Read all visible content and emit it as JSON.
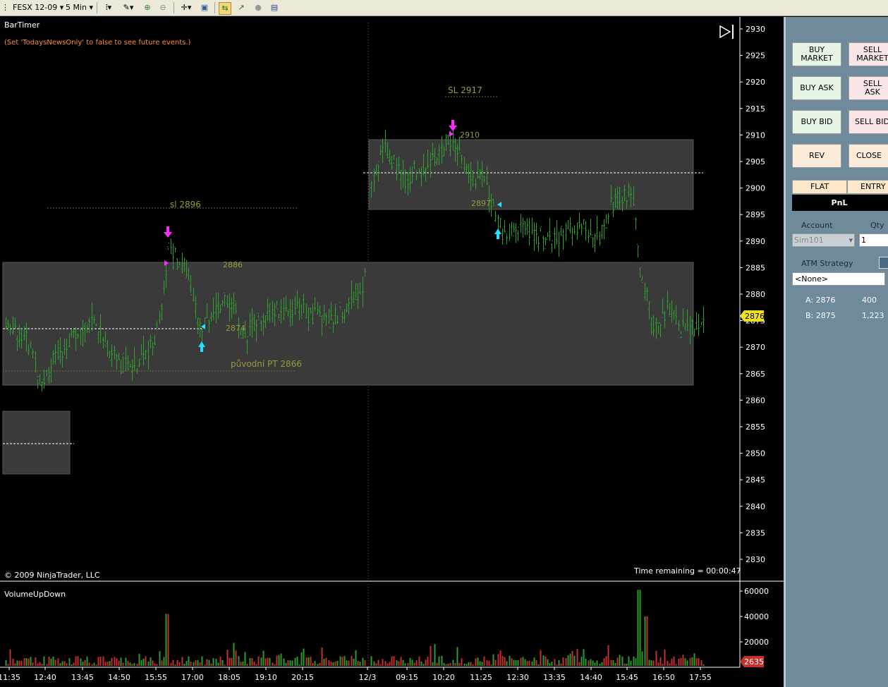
{
  "toolbar": {
    "instrument": "FESX 12-09",
    "period": "5 Min"
  },
  "chart": {
    "indicator_title": "BarTimer",
    "news_note": "(Set 'TodaysNewsOnly' to false to see future events.)",
    "copyright": "© 2009 NinjaTrader, LLC",
    "time_remaining": "Time remaining = 00:00:47",
    "volume_title": "VolumeUpDown",
    "price_ticks": [
      "2930",
      "2925",
      "2920",
      "2915",
      "2910",
      "2905",
      "2900",
      "2895",
      "2890",
      "2885",
      "2880",
      "2875",
      "2870",
      "2865",
      "2860",
      "2855",
      "2850",
      "2845",
      "2840",
      "2835",
      "2830"
    ],
    "current_price": "2876",
    "volume_ticks": [
      "60000",
      "40000",
      "20000"
    ],
    "current_volume": "2635",
    "time_ticks": [
      "11:35",
      "12:40",
      "13:45",
      "14:50",
      "15:55",
      "17:00",
      "18:05",
      "19:10",
      "20:15",
      "12/3",
      "09:15",
      "10:20",
      "11:25",
      "12:30",
      "13:35",
      "14:40",
      "15:45",
      "16:50",
      "17:55"
    ],
    "annotations": {
      "sl1": "sl  2896",
      "sl2": "SL 2917",
      "lvl_2886": "2886",
      "lvl_2874": "2874",
      "lvl_2866": "původní PT 2866",
      "lvl_2910": "2910",
      "lvl_2897": "2897"
    }
  },
  "panel": {
    "buy_market": "BUY MARKET",
    "sell_market": "SELL MARKET",
    "buy_ask": "BUY ASK",
    "sell_ask": "SELL ASK",
    "buy_bid": "BUY BID",
    "sell_bid": "SELL BID",
    "rev": "REV",
    "close": "CLOSE",
    "flat": "FLAT",
    "entry": "ENTRY",
    "pnl": "PnL",
    "account_label": "Account",
    "qty_label": "Qty",
    "account_value": "Sim101",
    "qty_value": "1",
    "atm_label": "ATM Strategy",
    "atm_value": "<None>",
    "ask_label": "A: 2876",
    "ask_size": "400",
    "bid_label": "B: 2875",
    "bid_size": "1,223"
  },
  "colors": {
    "up_bar": "#2fa02f",
    "volume_up": "#2e9a2e",
    "volume_down": "#c43030",
    "zone": "#3a3a3a",
    "annotation": "#9a9a3a",
    "arrow_down": "#ff2aff",
    "arrow_up": "#22e0ff",
    "price_marker": "#f0e020"
  }
}
